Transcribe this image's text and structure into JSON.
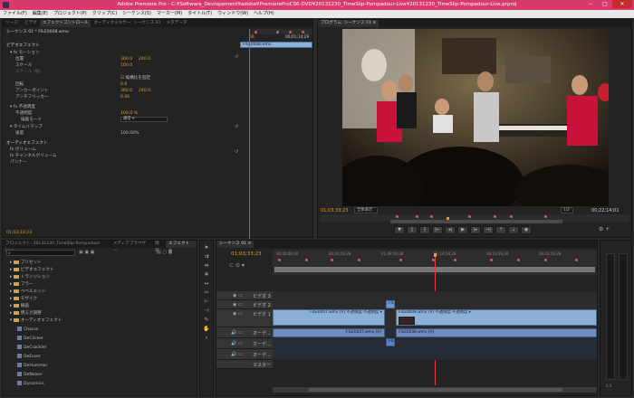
{
  "title": "Adobe Premiere Pro - C:¥Software_Devlopement¥adobe¥PremiereProCS6-DVD¥20131230_TimeSlip-Pompadour-Live¥20131230_TimeSlip-Pompadour-Live.prproj",
  "menu": [
    "ファイル(F)",
    "編集(E)",
    "プロジェクト(P)",
    "クリップ(C)",
    "シーケンス(S)",
    "マーカー(M)",
    "タイトル(T)",
    "ウィンドウ(W)",
    "ヘルプ(H)"
  ],
  "effects_panel": {
    "tabs": [
      "ソース:",
      "ビデオ",
      "エフェクトコントロール",
      "オーディオミキサー: シーケンス 01",
      "メタデータ"
    ],
    "header": "シーケンス 01 * FILE0008.wmv",
    "timecode": "00;01;14;29",
    "clip_name": "FILE0008.wmv",
    "section_video": "ビデオエフェクト",
    "rows": [
      {
        "label": "fx  モーション",
        "v1": "",
        "v2": ""
      },
      {
        "label": "位置",
        "v1": "360.0",
        "v2": "240.0"
      },
      {
        "label": "スケール",
        "v1": "100.0",
        "v2": ""
      },
      {
        "label": "スケール (幅)",
        "v1": "",
        "v2": ""
      },
      {
        "label": "縦横比を固定",
        "v1": "",
        "v2": ""
      },
      {
        "label": "回転",
        "v1": "0.0",
        "v2": ""
      },
      {
        "label": "アンカーポイント",
        "v1": "360.0",
        "v2": "240.0"
      },
      {
        "label": "アンチフリッカー",
        "v1": "0.00",
        "v2": ""
      },
      {
        "label": "fx  不透明度",
        "v1": "",
        "v2": ""
      },
      {
        "label": "不透明度",
        "v1": "100.0 %",
        "v2": ""
      },
      {
        "label": "描画モード",
        "v1": "通常",
        "v2": ""
      },
      {
        "label": "タイムリマップ",
        "v1": "",
        "v2": ""
      },
      {
        "label": "速度",
        "v1": "100.00%",
        "v2": ""
      }
    ],
    "section_audio": "オーディオエフェクト",
    "audio_rows": [
      "fx  ボリューム",
      "fx  チャンネルボリューム",
      "パンナー"
    ],
    "footer_tc": "01;03;33;23"
  },
  "program_monitor": {
    "tab": "プログラム: シーケンス 01 ≡",
    "tc_left": "01;03;33;23",
    "fit": "全体表示",
    "quality": "1/2",
    "tc_right": "00;22;14;01"
  },
  "project_panel": {
    "tabs": [
      "プロジェクト: 20131230_TimeSlip-Pompadour-Live",
      "メディアブラウザー",
      "情報",
      "エフェクト ≡"
    ],
    "folders": [
      "プリセット",
      "ビデオエフェクト",
      "トランジション",
      "ブラー",
      "ベベルエッジ",
      "モザイク",
      "線画",
      "明るさ調整",
      "オーディオエフェクト"
    ],
    "items": [
      "Chorus",
      "DeClicker",
      "DeCrackler",
      "DeEsser",
      "DeHummer",
      "DeNoiser",
      "Dynamics"
    ]
  },
  "timeline": {
    "tab": "シーケンス 01 ≡",
    "timecode": "01;03;33;23",
    "ruler": [
      "00;00;00;00",
      "00;04;59;28",
      "01;09;59;28",
      "01;14;59;28",
      "00;19;59;28",
      "00;24;59;28"
    ],
    "tracks": [
      "ビデオ 3",
      "ビデオ 2",
      "ビデオ 1",
      "オーデ...",
      "オーデ...",
      "オーデ...",
      "マスター"
    ],
    "clips": [
      {
        "label": "FILE0007.wmv [V] 不透明度:不透明度 ▾"
      },
      {
        "label": "FILE0008.wmv [V] 不透明度:不透明度 ▾"
      },
      {
        "label": "FILE0007.wmv [A]"
      },
      {
        "label": "FILE0008.wmv [A]"
      },
      {
        "label": "FILE"
      },
      {
        "label": "FILE"
      }
    ]
  },
  "colors": {
    "accent": "#d83a6c",
    "timecode": "#e0a020",
    "clip_video": "#8ab0d8",
    "clip_audio": "#6f8cbc",
    "playhead": "#e04040"
  }
}
